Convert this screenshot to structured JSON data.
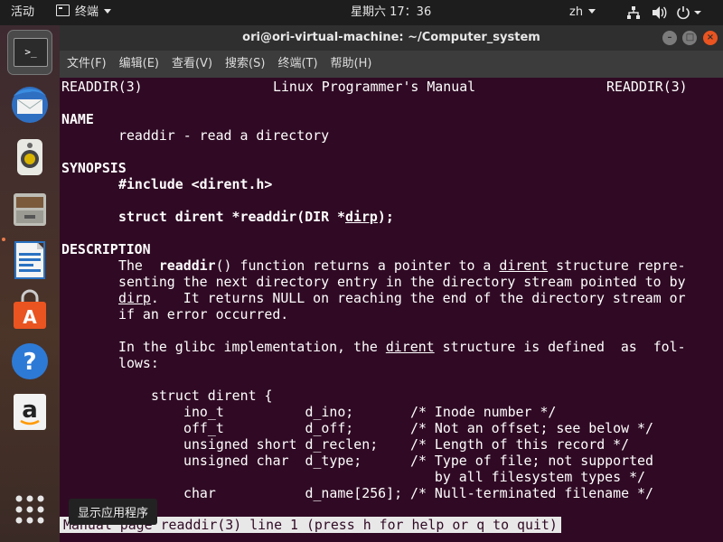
{
  "topbar": {
    "activities": "活动",
    "app_menu": "终端",
    "clock": "星期六 17：36",
    "input_lang": "zh"
  },
  "dock": {
    "tooltip": "显示应用程序",
    "terminal_glyph": ">_",
    "amazon_letter": "a"
  },
  "window": {
    "title": "ori@ori-virtual-machine: ~/Computer_system",
    "menu": [
      "文件(F)",
      "编辑(E)",
      "查看(V)",
      "搜索(S)",
      "终端(T)",
      "帮助(H)"
    ]
  },
  "man": {
    "header_left": "READDIR(3)",
    "header_center": "Linux Programmer's Manual",
    "header_right": "READDIR(3)",
    "sec_name": "NAME",
    "name_line": "readdir - read a directory",
    "sec_synopsis": "SYNOPSIS",
    "include_line": "#include <dirent.h>",
    "proto_a": "struct dirent *readdir(DIR *",
    "proto_arg": "dirp",
    "proto_b": ");",
    "sec_description": "DESCRIPTION",
    "d1_a": "The  ",
    "d1_fn": "readdir",
    "d1_b": "() function returns a pointer to a ",
    "d1_link": "dirent",
    "d1_c": " structure repre‐",
    "d2": "senting the next directory entry in the directory stream pointed to by",
    "d3_link": "dirp",
    "d3_rest": ".   It returns NULL on reaching the end of the directory stream or",
    "d4": "if an error occurred.",
    "d5_a": "In the glibc implementation, the ",
    "d5_link": "dirent",
    "d5_b": " structure is defined  as  fol‐",
    "d6": "lows:",
    "struct_open": "struct dirent {",
    "field_rows": [
      "ino_t          d_ino;       /* Inode number */",
      "off_t          d_off;       /* Not an offset; see below */",
      "unsigned short d_reclen;    /* Length of this record */",
      "unsigned char  d_type;      /* Type of file; not supported",
      "                               by all filesystem types */",
      "char           d_name[256]; /* Null-terminated filename */"
    ],
    "status": "Manual page readdir(3) line 1 (press h for help or q to quit)"
  }
}
